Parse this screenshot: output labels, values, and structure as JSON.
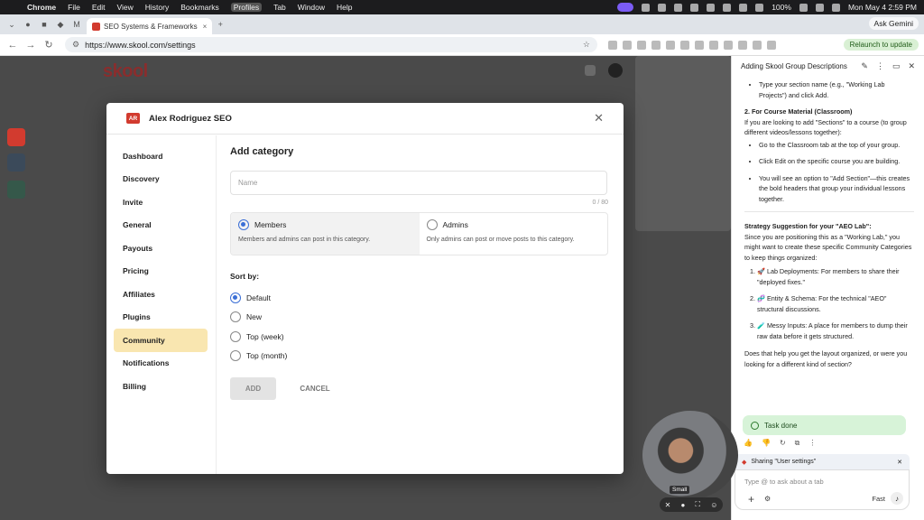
{
  "menubar": {
    "app": "Chrome",
    "items": [
      "File",
      "Edit",
      "View",
      "History",
      "Bookmarks",
      "Profiles",
      "Tab",
      "Window",
      "Help"
    ],
    "battery": "100%",
    "datetime": "Mon May 4  2:59 PM"
  },
  "tabs": {
    "active_label": "SEO Systems & Frameworks",
    "ask_gemini": "Ask Gemini"
  },
  "toolbar": {
    "url": "https://www.skool.com/settings",
    "relaunch": "Relaunch to update"
  },
  "page": {
    "logo": "skool"
  },
  "modal": {
    "group_badge": "AR",
    "group_name": "Alex Rodriguez SEO",
    "nav": [
      {
        "label": "Dashboard"
      },
      {
        "label": "Discovery"
      },
      {
        "label": "Invite"
      },
      {
        "label": "General"
      },
      {
        "label": "Payouts"
      },
      {
        "label": "Pricing"
      },
      {
        "label": "Affiliates"
      },
      {
        "label": "Plugins"
      },
      {
        "label": "Community"
      },
      {
        "label": "Notifications"
      },
      {
        "label": "Billing"
      }
    ],
    "title": "Add category",
    "name_placeholder": "Name",
    "counter": "0 / 80",
    "perm_members": {
      "label": "Members",
      "desc": "Members and admins can post in this category."
    },
    "perm_admins": {
      "label": "Admins",
      "desc": "Only admins can post or move posts to this category."
    },
    "sort_label": "Sort by:",
    "sort_options": [
      {
        "label": "Default"
      },
      {
        "label": "New"
      },
      {
        "label": "Top (week)"
      },
      {
        "label": "Top (month)"
      }
    ],
    "add_label": "ADD",
    "cancel_label": "CANCEL"
  },
  "gemini": {
    "title": "Adding Skool Group Descriptions",
    "bullet_top": "Type your section name (e.g., \"Working Lab Projects\") and click Add.",
    "course_heading": "2. For Course Material (Classroom)",
    "course_intro": "If you are looking to add \"Sections\" to a course (to group different videos/lessons together):",
    "course_b1": "Go to the Classroom tab at the top of your group.",
    "course_b2": "Click Edit on the specific course you are building.",
    "course_b3": "You will see an option to \"Add Section\"—this creates the bold headers that group your individual lessons together.",
    "strategy_heading": "Strategy Suggestion for your \"AEO Lab\":",
    "strategy_intro": "Since you are positioning this as a \"Working Lab,\" you might want to create these specific Community Categories to keep things organized:",
    "s1": "🚀 Lab Deployments: For members to share their \"deployed fixes.\"",
    "s2": "🧬 Entity & Schema: For the technical \"AEO\" structural discussions.",
    "s3": "🧪 Messy Inputs: A place for members to dump their raw data before it gets structured.",
    "closing": "Does that help you get the layout organized, or were you looking for a different kind of section?",
    "task_done": "Task done",
    "sharing": "Sharing \"User settings\"",
    "input_placeholder": "Type @ to ask about a tab",
    "mode": "Fast"
  },
  "cam": {
    "label": "Small"
  }
}
